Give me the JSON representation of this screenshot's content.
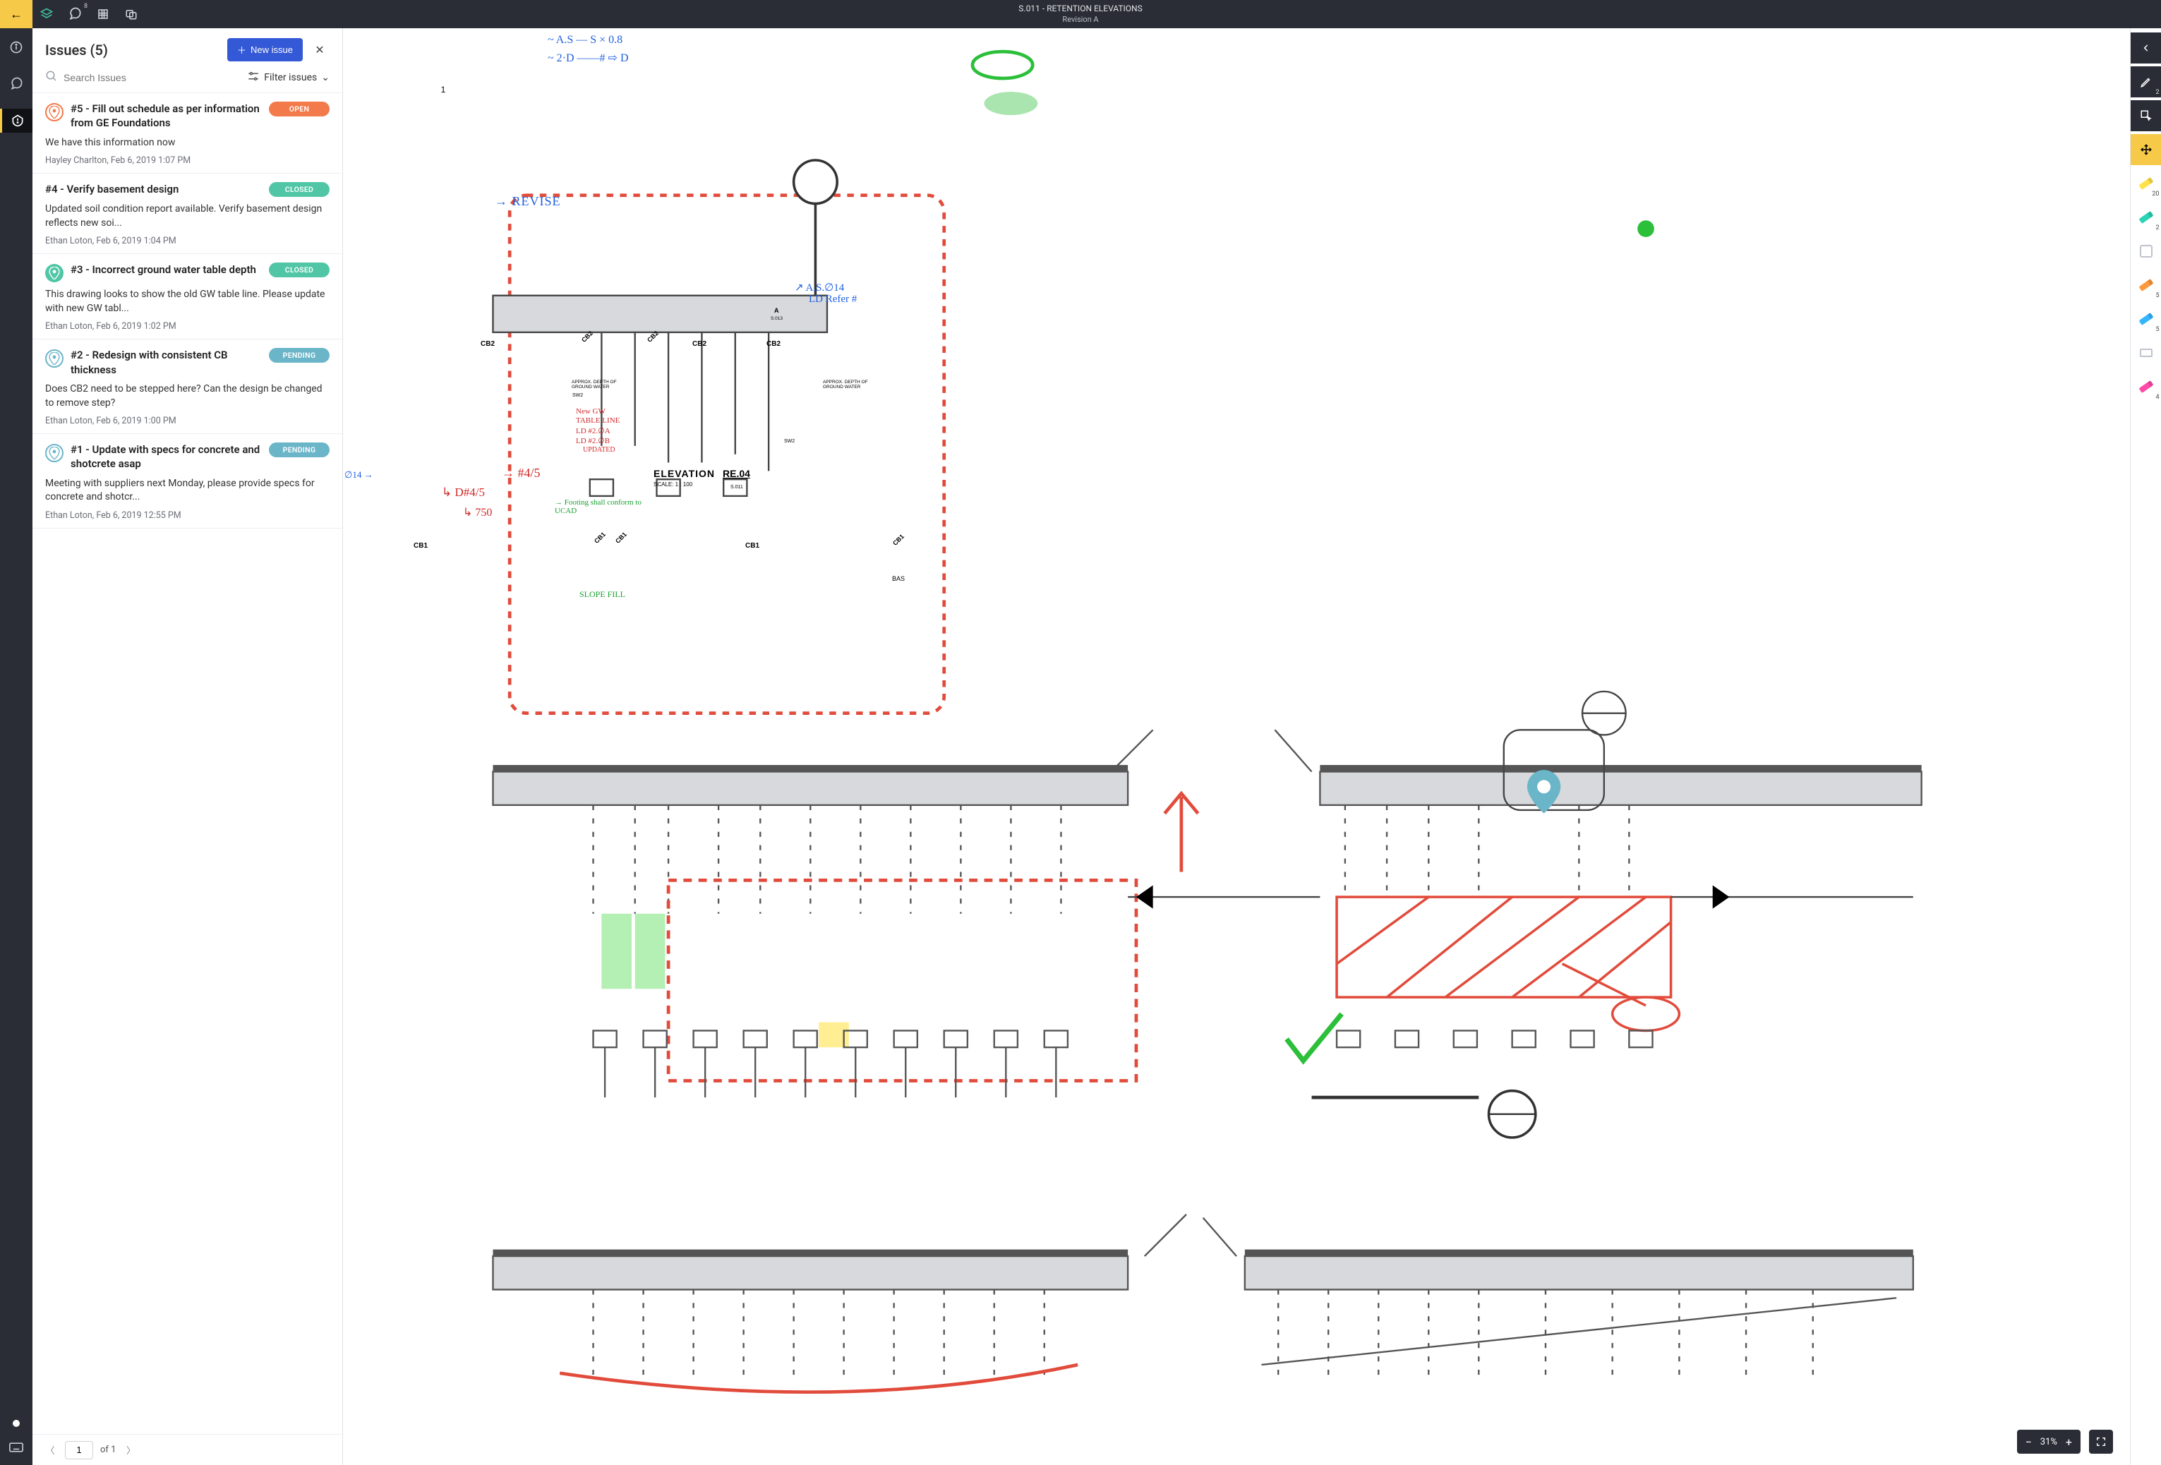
{
  "header": {
    "doc_title": "S.011 - RETENTION ELEVATIONS",
    "revision": "Revision A",
    "chat_badge": "8"
  },
  "issues_panel": {
    "title": "Issues (5)",
    "new_issue_label": "New issue",
    "search_placeholder": "Search Issues",
    "filter_label": "Filter issues",
    "pager": {
      "current": "1",
      "of_label": "of 1"
    },
    "issues": [
      {
        "title": "#5 - Fill out schedule as per information from GE Foundations",
        "status": "OPEN",
        "pin_style": "pin-open",
        "pin_color": "#f27a4b",
        "desc": "We have this information now",
        "author": "Hayley Charlton",
        "date": "Feb 6, 2019 1:07 PM"
      },
      {
        "title": "#4 - Verify basement design",
        "status": "CLOSED",
        "pin_style": "pin-closed",
        "pin_color": "#ffffff",
        "no_pin": true,
        "desc": "Updated soil condition report available. Verify basement design reflects new soi...",
        "author": "Ethan Loton",
        "date": "Feb 6, 2019 1:04 PM"
      },
      {
        "title": "#3 - Incorrect ground water table depth",
        "status": "CLOSED",
        "pin_style": "pin-closed",
        "pin_color": "#ffffff",
        "desc": "This drawing looks to show the old GW table line. Please update with new GW tabl...",
        "author": "Ethan Loton",
        "date": "Feb 6, 2019 1:02 PM"
      },
      {
        "title": "#2 - Redesign with consistent CB thickness",
        "status": "PENDING",
        "pin_style": "pin-pending",
        "pin_color": "#6bb5c9",
        "desc": "Does CB2 need to be stepped here? Can the design be changed to remove step?",
        "author": "Ethan Loton",
        "date": "Feb 6, 2019 1:00 PM"
      },
      {
        "title": "#1 - Update with specs for concrete and shotcrete asap",
        "status": "PENDING",
        "pin_style": "pin-pending",
        "pin_color": "#6bb5c9",
        "desc": "Meeting with suppliers next Monday, please provide specs for concrete and shotcr...",
        "author": "Ethan Loton",
        "date": "Feb 6, 2019 12:55 PM"
      }
    ]
  },
  "zoom": {
    "value": "31%"
  },
  "right_rail_counts": {
    "pencil": "2",
    "yellow": "20",
    "teal": "2",
    "orange": "5",
    "blue": "5",
    "pink": "4"
  },
  "annotations": {
    "top1": "~ A.S — S × 0.8",
    "top2": "~ 2·D ——# ⇨ D",
    "revise": "→ REVISE",
    "as14": "↗ A.S.∅14",
    "ldref": "LD Refer #",
    "hash45a": "→ #4/5",
    "d45": "↳ D#4/5",
    "seven50": "↳ 750",
    "footing": "→ Footing shall conform to UCAD",
    "slope": "SLOPE FILL",
    "newgw1": "New GW",
    "newgw2": "TABLE LINE",
    "newgw3": "LD #2.∅A",
    "newgw4": "LD #2.∅B",
    "newgw5": "UPDATED",
    "phi14": "∅14 →"
  },
  "drawing": {
    "circle_1": "1",
    "cb2": "CB2",
    "cb1": "CB1",
    "sw2": "SW2",
    "gw_label": "APPROX. DEPTH OF GROUND WATER",
    "elev_title": "ELEVATION",
    "elev_code": "RE.04",
    "elev_scale": "SCALE:   1 : 100",
    "elev_sheet": "S.011",
    "callout_a": "A",
    "callout_sheet": "S.013",
    "bas": "BAS"
  }
}
